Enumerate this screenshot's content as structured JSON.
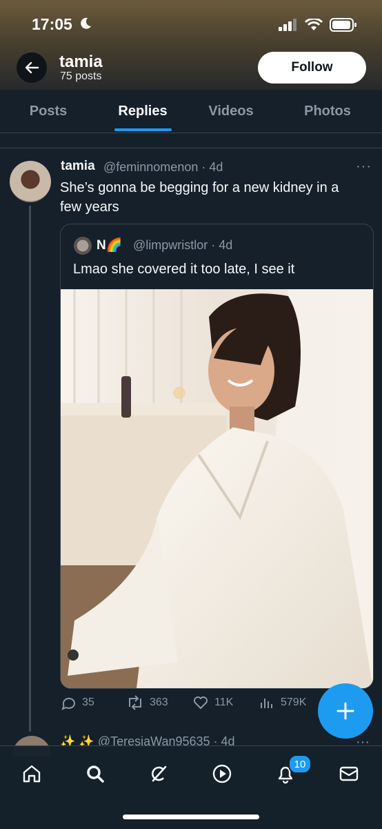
{
  "status_bar": {
    "time": "17:05"
  },
  "header": {
    "name": "tamia",
    "posts": "75 posts",
    "follow_label": "Follow"
  },
  "tabs": [
    {
      "label": "Posts",
      "active": false
    },
    {
      "label": "Replies",
      "active": true
    },
    {
      "label": "Videos",
      "active": false
    },
    {
      "label": "Photos",
      "active": false
    }
  ],
  "tweet": {
    "name": "tamia",
    "handle": "@feminnomenon · 4d",
    "text": "She’s gonna be begging for a new kidney in a few years",
    "more": "···",
    "quote": {
      "name": "N🌈",
      "handle": "@limpwristlor · 4d",
      "text": "Lmao she covered it too late, I see it"
    },
    "actions": {
      "replies": "35",
      "reposts": "363",
      "likes": "11K",
      "views": "579K"
    }
  },
  "next_tweet": {
    "handle": "✨ ✨ @TeresiaWan95635 · 4d",
    "more": "···"
  },
  "nav": {
    "notifications_badge": "10"
  },
  "colors": {
    "accent": "#1d9bf0",
    "background": "#15202b"
  }
}
